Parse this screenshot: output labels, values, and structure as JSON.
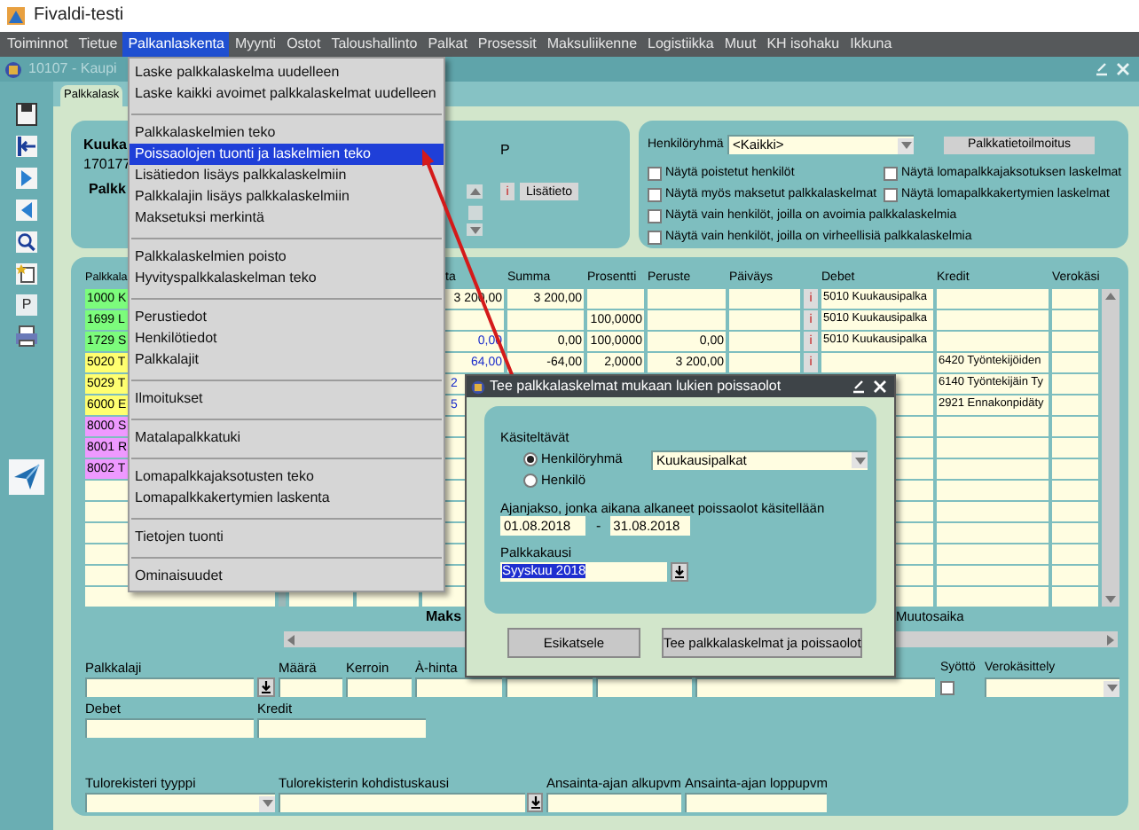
{
  "window": {
    "title": "Fivaldi-testi"
  },
  "menu_bar": [
    {
      "label": "Toiminnot",
      "selected": false
    },
    {
      "label": "Tietue",
      "selected": false
    },
    {
      "label": "Palkanlaskenta",
      "selected": true
    },
    {
      "label": "Myynti",
      "selected": false
    },
    {
      "label": "Ostot",
      "selected": false
    },
    {
      "label": "Taloushallinto",
      "selected": false
    },
    {
      "label": "Palkat",
      "selected": false
    },
    {
      "label": "Prosessit",
      "selected": false
    },
    {
      "label": "Maksuliikenne",
      "selected": false
    },
    {
      "label": "Logistiikka",
      "selected": false
    },
    {
      "label": "Muut",
      "selected": false
    },
    {
      "label": "KH isohaku",
      "selected": false
    },
    {
      "label": "Ikkuna",
      "selected": false
    }
  ],
  "menu": [
    {
      "kind": "item",
      "label": "Laske palkkalaskelma uudelleen",
      "selected": false
    },
    {
      "kind": "item",
      "label": "Laske kaikki avoimet palkkalaskelmat uudelleen",
      "selected": false
    },
    {
      "kind": "separator"
    },
    {
      "kind": "item",
      "label": "Palkkalaskelmien teko",
      "selected": false
    },
    {
      "kind": "item",
      "label": "Poissaolojen tuonti ja laskelmien teko",
      "selected": true
    },
    {
      "kind": "item",
      "label": "Lisätiedon lisäys palkkalaskelmiin",
      "selected": false
    },
    {
      "kind": "item",
      "label": "Palkkalajin lisäys palkkalaskelmiin",
      "selected": false
    },
    {
      "kind": "item",
      "label": "Maksetuksi merkintä",
      "selected": false
    },
    {
      "kind": "separator"
    },
    {
      "kind": "item",
      "label": "Palkkalaskelmien poisto",
      "selected": false
    },
    {
      "kind": "item",
      "label": "Hyvityspalkkalaskelman teko",
      "selected": false
    },
    {
      "kind": "separator"
    },
    {
      "kind": "item",
      "label": "Perustiedot",
      "selected": false
    },
    {
      "kind": "item",
      "label": "Henkilötiedot",
      "selected": false
    },
    {
      "kind": "item",
      "label": "Palkkalajit",
      "selected": false
    },
    {
      "kind": "separator"
    },
    {
      "kind": "item",
      "label": "Ilmoitukset",
      "selected": false
    },
    {
      "kind": "separator"
    },
    {
      "kind": "item",
      "label": "Matalapalkkatuki",
      "selected": false
    },
    {
      "kind": "separator"
    },
    {
      "kind": "item",
      "label": "Lomapalkkajaksotusten teko",
      "selected": false
    },
    {
      "kind": "item",
      "label": "Lomapalkkakertymien laskenta",
      "selected": false
    },
    {
      "kind": "separator"
    },
    {
      "kind": "item",
      "label": "Tietojen tuonti",
      "selected": false
    },
    {
      "kind": "separator"
    },
    {
      "kind": "item",
      "label": "Ominaisuudet",
      "selected": false
    }
  ],
  "form": {
    "title": "10107 - Kaupi",
    "tab": "Palkkalask",
    "toolbar_letter": "P",
    "header": {
      "month_label": "Kuuka",
      "id": "170177",
      "pay_label": "Palkk",
      "p_label": "P",
      "info_button": "i",
      "extra_button": "Lisätieto"
    },
    "filters": {
      "group_label": "Henkilöryhmä",
      "group_value": "<Kaikki>",
      "report_button": "Palkkatietoilmoitus",
      "checkboxes": [
        {
          "label": "Näytä poistetut henkilöt",
          "checked": false
        },
        {
          "label": "Näytä lomapalkkajaksotuksen laskelmat",
          "checked": false
        },
        {
          "label": "Näytä myös maksetut palkkalaskelmat",
          "checked": false
        },
        {
          "label": "Näytä lomapalkkakertymien laskelmat",
          "checked": false
        },
        {
          "label": "Näytä vain henkilöt, joilla on avoimia palkkalaskelmia",
          "checked": false
        },
        {
          "label": "Näytä vain henkilöt, joilla on virheellisiä palkkalaskelmia",
          "checked": false
        }
      ]
    },
    "table": {
      "columns": [
        "Palkkala",
        "ta",
        "Summa",
        "Prosentti",
        "Peruste",
        "Päiväys",
        "Debet",
        "Kredit",
        "Verokäsi"
      ],
      "rows": [
        {
          "code": "1000 K",
          "color": "#7cfc7c",
          "a_hinta": "3 200,00",
          "a_hinta_calculated": false,
          "a_hinta_clipped": false,
          "summa": "3 200,00",
          "info": "i",
          "debet": "5010 Kuukausipalka"
        },
        {
          "code": "1699 L",
          "color": "#7cfc7c",
          "prosentti": "100,0000",
          "info": "i",
          "debet": "5010 Kuukausipalka"
        },
        {
          "code": "1729 S",
          "color": "#7cfc7c",
          "a_hinta": "0,00",
          "a_hinta_calculated": true,
          "a_hinta_clipped": false,
          "summa": "0,00",
          "prosentti": "100,0000",
          "peruste": "0,00",
          "info": "i",
          "debet": "5010 Kuukausipalka"
        },
        {
          "code": "5020 T",
          "color": "#ffff70",
          "a_hinta": "64,00",
          "a_hinta_calculated": true,
          "a_hinta_clipped": false,
          "summa": "-64,00",
          "prosentti": "2,0000",
          "peruste": "3 200,00",
          "info": "i",
          "kredit": "6420 Työntekijöiden"
        },
        {
          "code": "5029 T",
          "color": "#ffff70",
          "a_hinta": "2",
          "a_hinta_calculated": true,
          "a_hinta_clipped": true,
          "kredit": "6140 Työntekijäin Ty"
        },
        {
          "code": "6000 E",
          "color": "#ffff70",
          "a_hinta": "5",
          "a_hinta_calculated": true,
          "a_hinta_clipped": true,
          "kredit": "2921 Ennakonpidäty"
        },
        {
          "code": "8000 S",
          "color": "#ee99ff"
        },
        {
          "code": "8001 R",
          "color": "#ee99ff"
        },
        {
          "code": "8002 T",
          "color": "#ee99ff"
        }
      ]
    },
    "footer_label": "Maks",
    "footer_label_2": "Muutosaika",
    "detail": {
      "pay_type": "Palkkalaji",
      "amount": "Määrä",
      "factor": "Kerroin",
      "unit_price": "À-hinta",
      "entry": "Syöttö",
      "entry_checked": false,
      "tax": "Verokäsittely",
      "debet": "Debet",
      "kredit": "Kredit",
      "register_type": "Tulorekisteri tyyppi",
      "register_period": "Tulorekisterin kohdistuskausi",
      "earning_start": "Ansainta-ajan alkupvm",
      "earning_end": "Ansainta-ajan loppupvm"
    }
  },
  "dialog": {
    "title": "Tee palkkalaskelmat mukaan lukien poissaolot",
    "section": "Käsiteltävät",
    "options": [
      {
        "label": "Henkilöryhmä",
        "selected": true
      },
      {
        "label": "Henkilö",
        "selected": false
      }
    ],
    "group_value": "Kuukausipalkat",
    "period_label": "Ajanjakso, jonka aikana alkaneet poissaolot käsitellään",
    "start": "01.08.2018",
    "separator": "-",
    "end": "31.08.2018",
    "pay_period_label": "Palkkakausi",
    "pay_period": "Syyskuu 2018",
    "pay_period_highlighted": true,
    "buttons": [
      "Esikatsele",
      "Tee palkkalaskelmat ja poissaolot"
    ]
  }
}
